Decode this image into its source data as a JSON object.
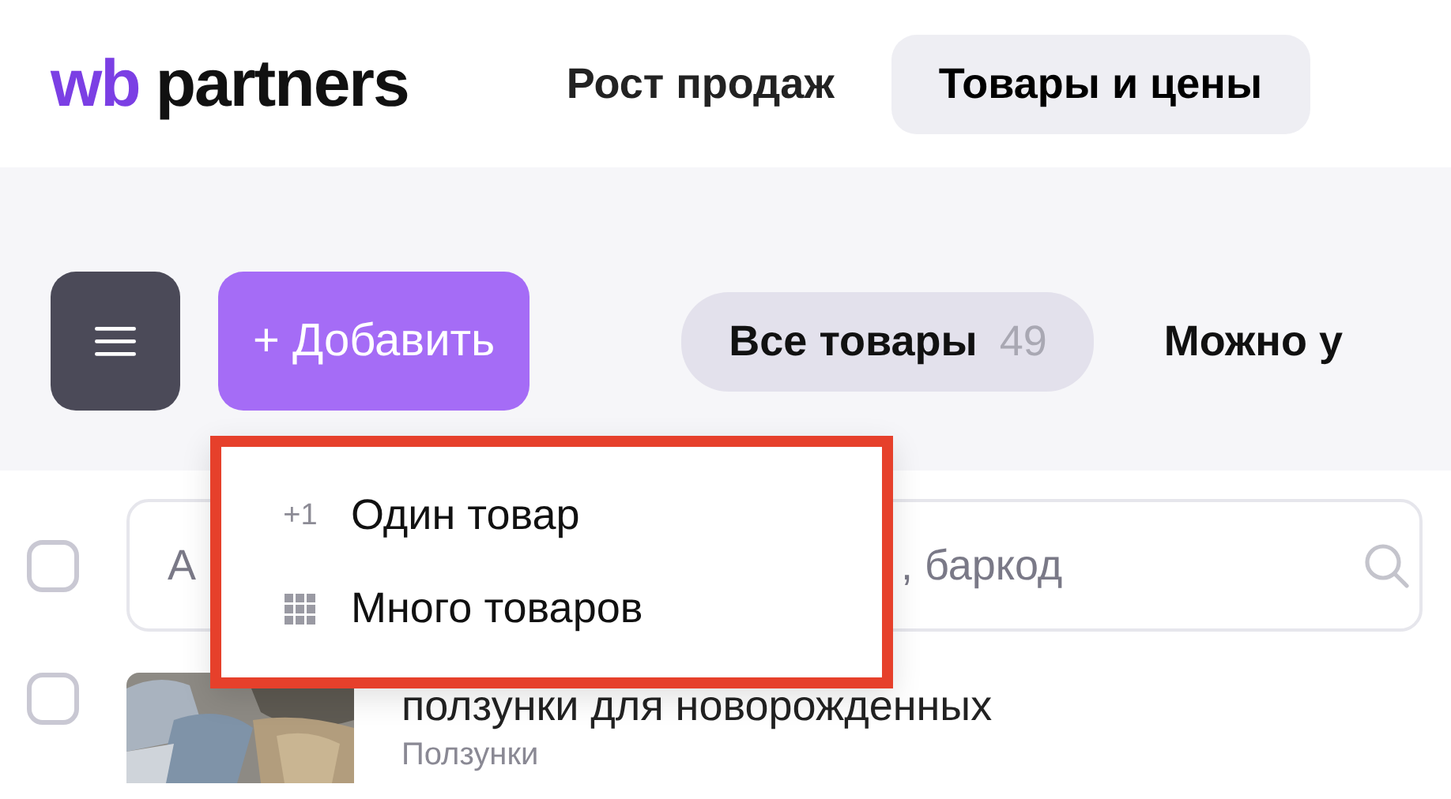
{
  "logo": {
    "brand": "wb",
    "name": "partners"
  },
  "nav": [
    {
      "label": "Рост продаж",
      "selected": false
    },
    {
      "label": "Товары и цены",
      "selected": true
    }
  ],
  "toolbar": {
    "add_button": "+ Добавить"
  },
  "filters": [
    {
      "label": "Все товары",
      "count": "49",
      "selected": true
    },
    {
      "label": "Можно у",
      "selected": false
    }
  ],
  "select_all": {
    "checked": false
  },
  "search": {
    "visible_start": "А",
    "visible_end": ", баркод"
  },
  "products": [
    {
      "checked": false,
      "title": "ползунки для новорожденных",
      "subtitle": "Ползунки"
    }
  ],
  "add_menu": {
    "items": [
      {
        "kind": "plus-one",
        "icon_text": "+1",
        "label": "Один товар"
      },
      {
        "kind": "grid",
        "label": "Много товаров"
      }
    ]
  }
}
